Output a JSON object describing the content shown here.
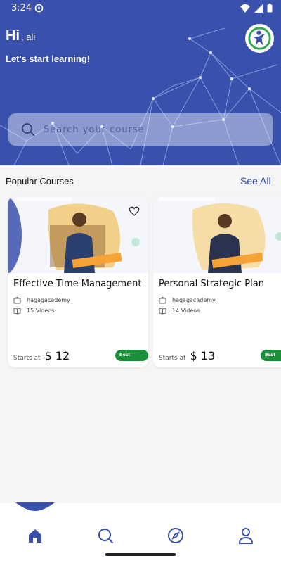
{
  "status": {
    "time": "3:24",
    "icons": [
      "settings-icon",
      "wifi-icon",
      "signal-icon",
      "battery-icon"
    ]
  },
  "header": {
    "greeting": "Hi",
    "user_name": ", ali",
    "subtitle": "Let's start learning!"
  },
  "search": {
    "placeholder": "Search your course"
  },
  "section": {
    "title": "Popular Courses",
    "see_all": "See All"
  },
  "courses": [
    {
      "title": "Effective Time Management",
      "provider": "hagagacademy",
      "videos": "15 Videos",
      "price_label": "Starts at",
      "price": "$ 12",
      "badge": "Best Seller",
      "thumb_bg": "#f3d08a"
    },
    {
      "title": "Personal Strategic Plan",
      "provider": "hagagacademy",
      "videos": "14 Videos",
      "price_label": "Starts at",
      "price": "$ 13",
      "badge": "Best Seller",
      "thumb_bg": "#f6dca7"
    }
  ],
  "nav": {
    "items": [
      "home-icon",
      "search-icon",
      "explore-icon",
      "profile-icon"
    ]
  },
  "colors": {
    "primary": "#3951ad",
    "accent": "#2f4aa2",
    "success": "#1b8f3a"
  }
}
